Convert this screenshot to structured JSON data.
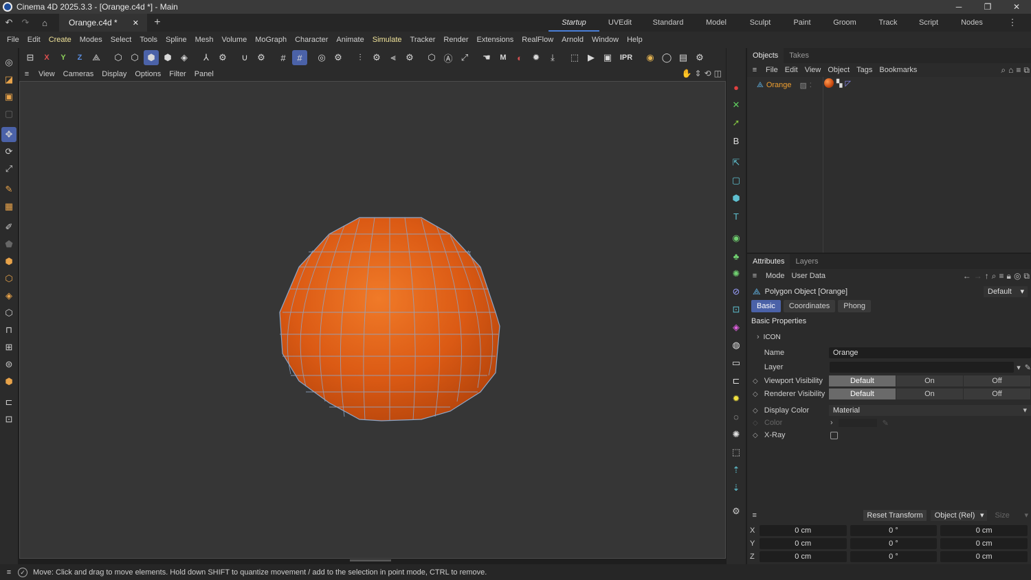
{
  "window": {
    "title": "Cinema 4D 2025.3.3 - [Orange.c4d *] - Main",
    "controls": [
      "─",
      "❐",
      "✕"
    ]
  },
  "tabs": {
    "document": "Orange.c4d *",
    "close": "✕",
    "add": "+",
    "layouts": [
      "Startup",
      "UVEdit",
      "Standard",
      "Model",
      "Sculpt",
      "Paint",
      "Groom",
      "Track",
      "Script",
      "Nodes"
    ],
    "active_layout": "Startup"
  },
  "menubar": [
    "File",
    "Edit",
    "Create",
    "Modes",
    "Select",
    "Tools",
    "Spline",
    "Mesh",
    "Volume",
    "MoGraph",
    "Character",
    "Animate",
    "Simulate",
    "Tracker",
    "Render",
    "Extensions",
    "RealFlow",
    "Arnold",
    "Window",
    "Help"
  ],
  "toolbar": {
    "axis_x": "X",
    "axis_y": "Y",
    "axis_z": "Z",
    "ipr": "IPR"
  },
  "viewport_menu": [
    "View",
    "Cameras",
    "Display",
    "Options",
    "Filter",
    "Panel"
  ],
  "objects": {
    "tabs": [
      "Objects",
      "Takes"
    ],
    "menu": [
      "File",
      "Edit",
      "View",
      "Object",
      "Tags",
      "Bookmarks"
    ],
    "items": [
      {
        "name": "Orange",
        "icon": "polygon-object-icon"
      }
    ]
  },
  "attributes": {
    "tabs": [
      "Attributes",
      "Layers"
    ],
    "menu": [
      "Mode",
      "User Data"
    ],
    "object_title": "Polygon Object [Orange]",
    "preset": "Default",
    "subtabs": [
      "Basic",
      "Coordinates",
      "Phong"
    ],
    "section": "Basic Properties",
    "icon_group": "ICON",
    "name_label": "Name",
    "name_value": "Orange",
    "layer_label": "Layer",
    "viewport_visibility_label": "Viewport Visibility",
    "renderer_visibility_label": "Renderer Visibility",
    "visibility_options": [
      "Default",
      "On",
      "Off"
    ],
    "display_color_label": "Display Color",
    "display_color_value": "Material",
    "color_label": "Color",
    "xray_label": "X-Ray"
  },
  "coordinates": {
    "reset_button": "Reset Transform",
    "mode": "Object (Rel)",
    "size_mode": "Size",
    "rows": [
      {
        "axis": "X",
        "pos": "0 cm",
        "rot": "0 °",
        "size": "0 cm"
      },
      {
        "axis": "Y",
        "pos": "0 cm",
        "rot": "0 °",
        "size": "0 cm"
      },
      {
        "axis": "Z",
        "pos": "0 cm",
        "rot": "0 °",
        "size": "0 cm"
      }
    ]
  },
  "status": {
    "message": "Move: Click and drag to move elements. Hold down SHIFT to quantize movement / add to the selection in point mode, CTRL to remove."
  },
  "colors": {
    "accent": "#4b62a8",
    "object_name": "#f0a030",
    "orange_fill": "#e0601a",
    "wire": "#8fa7c8"
  }
}
